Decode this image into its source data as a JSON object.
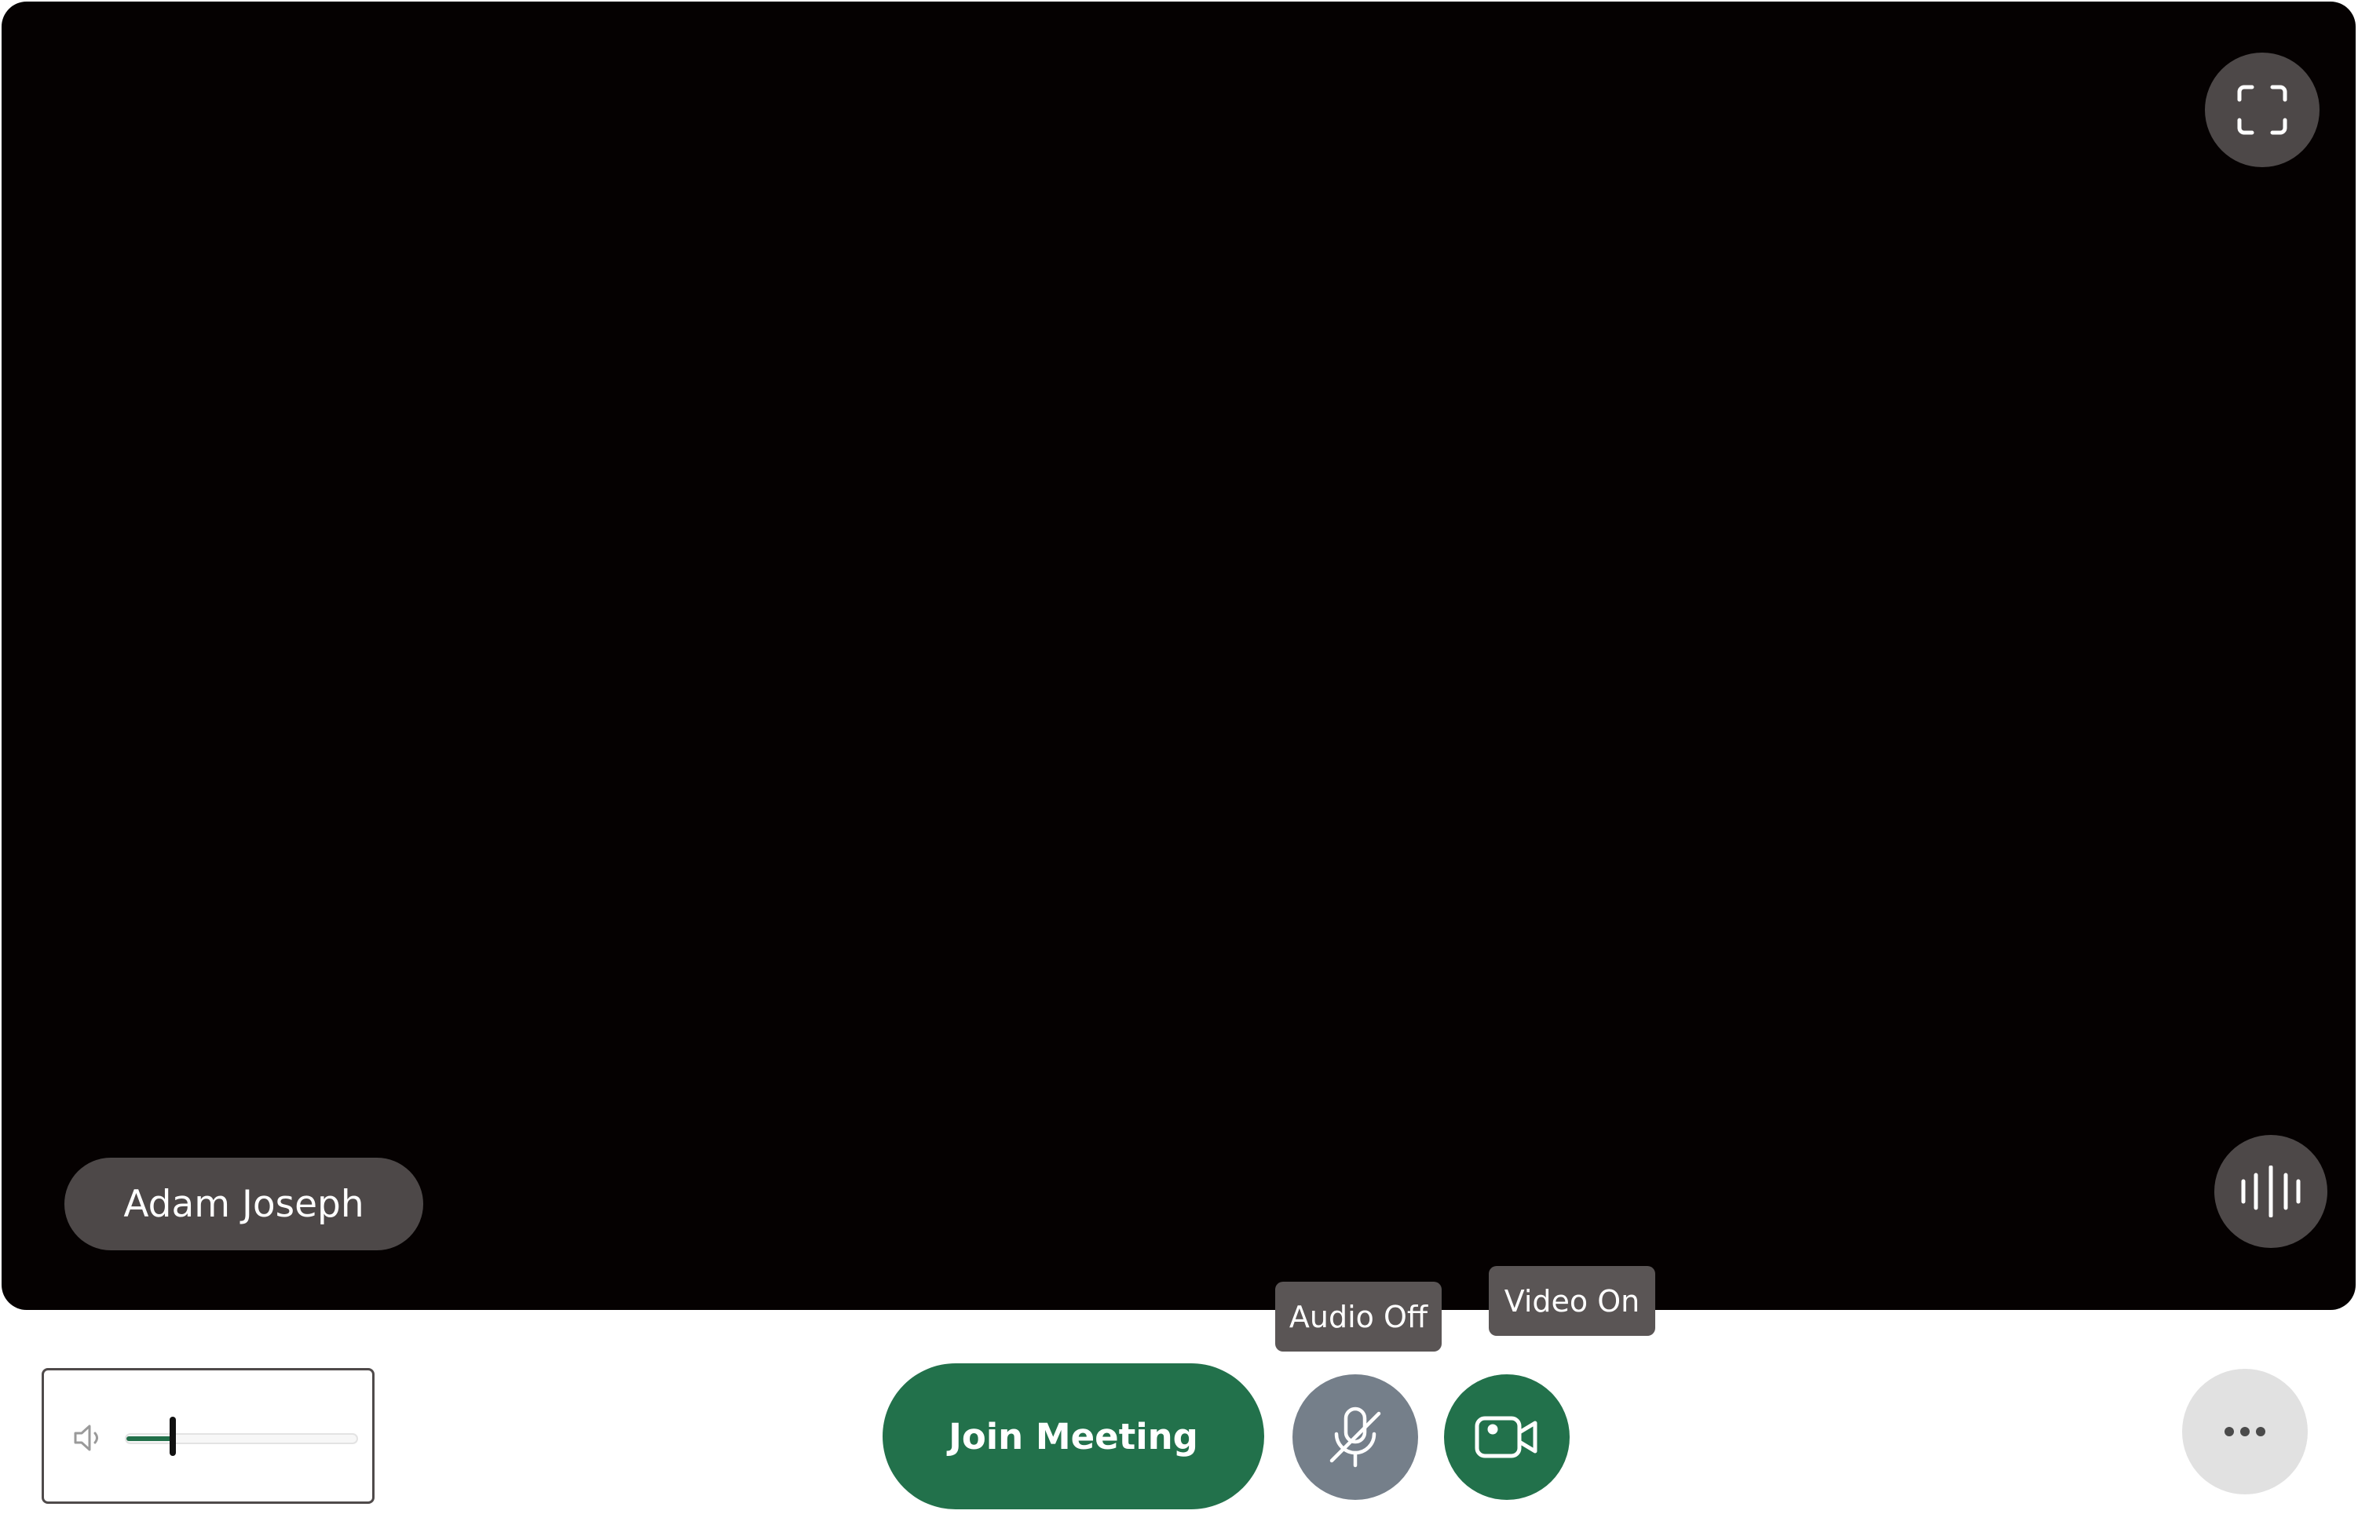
{
  "participant": {
    "name": "Adam Joseph"
  },
  "video_area": {
    "fullscreen_icon": "fullscreen-focus-icon",
    "audio_level_icon": "audio-waveform-icon"
  },
  "volume": {
    "icon": "speaker-low-icon",
    "level_percent": 20
  },
  "controls": {
    "join_label": "Join Meeting",
    "mic_icon": "mic-off-icon",
    "video_icon": "video-camera-icon",
    "more_icon": "more-horizontal-icon"
  },
  "tooltips": {
    "audio": "Audio Off",
    "video": "Video On"
  },
  "colors": {
    "accent_green": "#22714b",
    "video_background": "#050101",
    "mic_off_gray": "#757f8a",
    "overlay_dark": "#4d4848"
  }
}
